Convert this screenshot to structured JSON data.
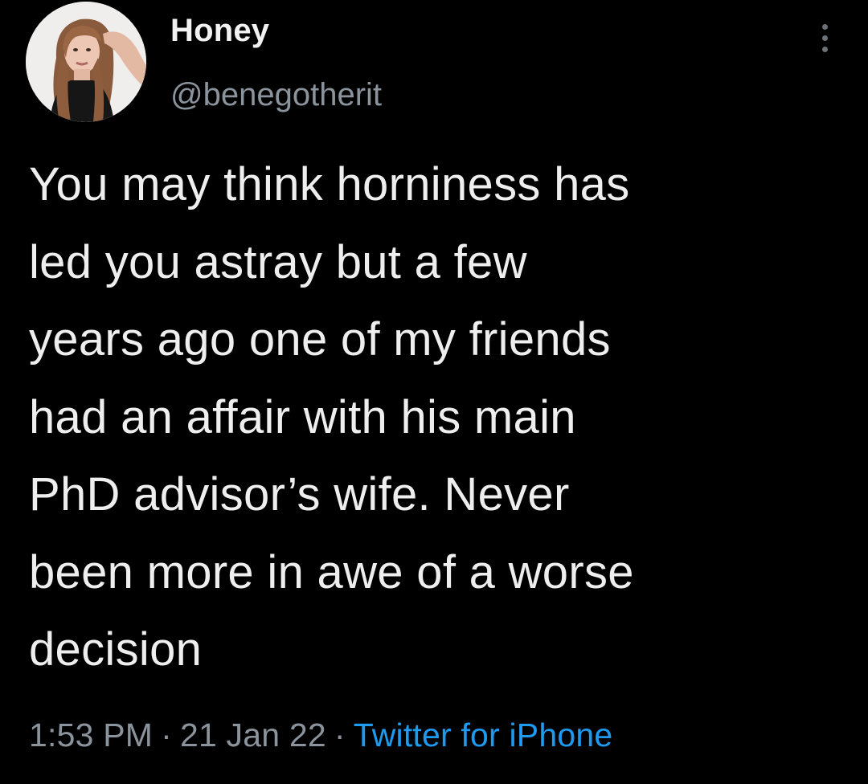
{
  "tweet": {
    "author": {
      "display_name": "Honey",
      "handle": "@benegotherit",
      "avatar_icon": "profile-photo"
    },
    "more_icon": "more-vertical-icon",
    "text": "You may think horniness has\nled you astray but a few\nyears ago one of my friends\nhad an affair with his main\nPhD advisor’s wife. Never\nbeen more in awe of a worse\ndecision",
    "time": "1:53 PM",
    "date": "21 Jan 22",
    "separator": "·",
    "source": "Twitter for iPhone"
  },
  "colors": {
    "background": "#000000",
    "text": "#eeeeee",
    "secondary": "#8b949c",
    "link": "#1d9bf0"
  }
}
